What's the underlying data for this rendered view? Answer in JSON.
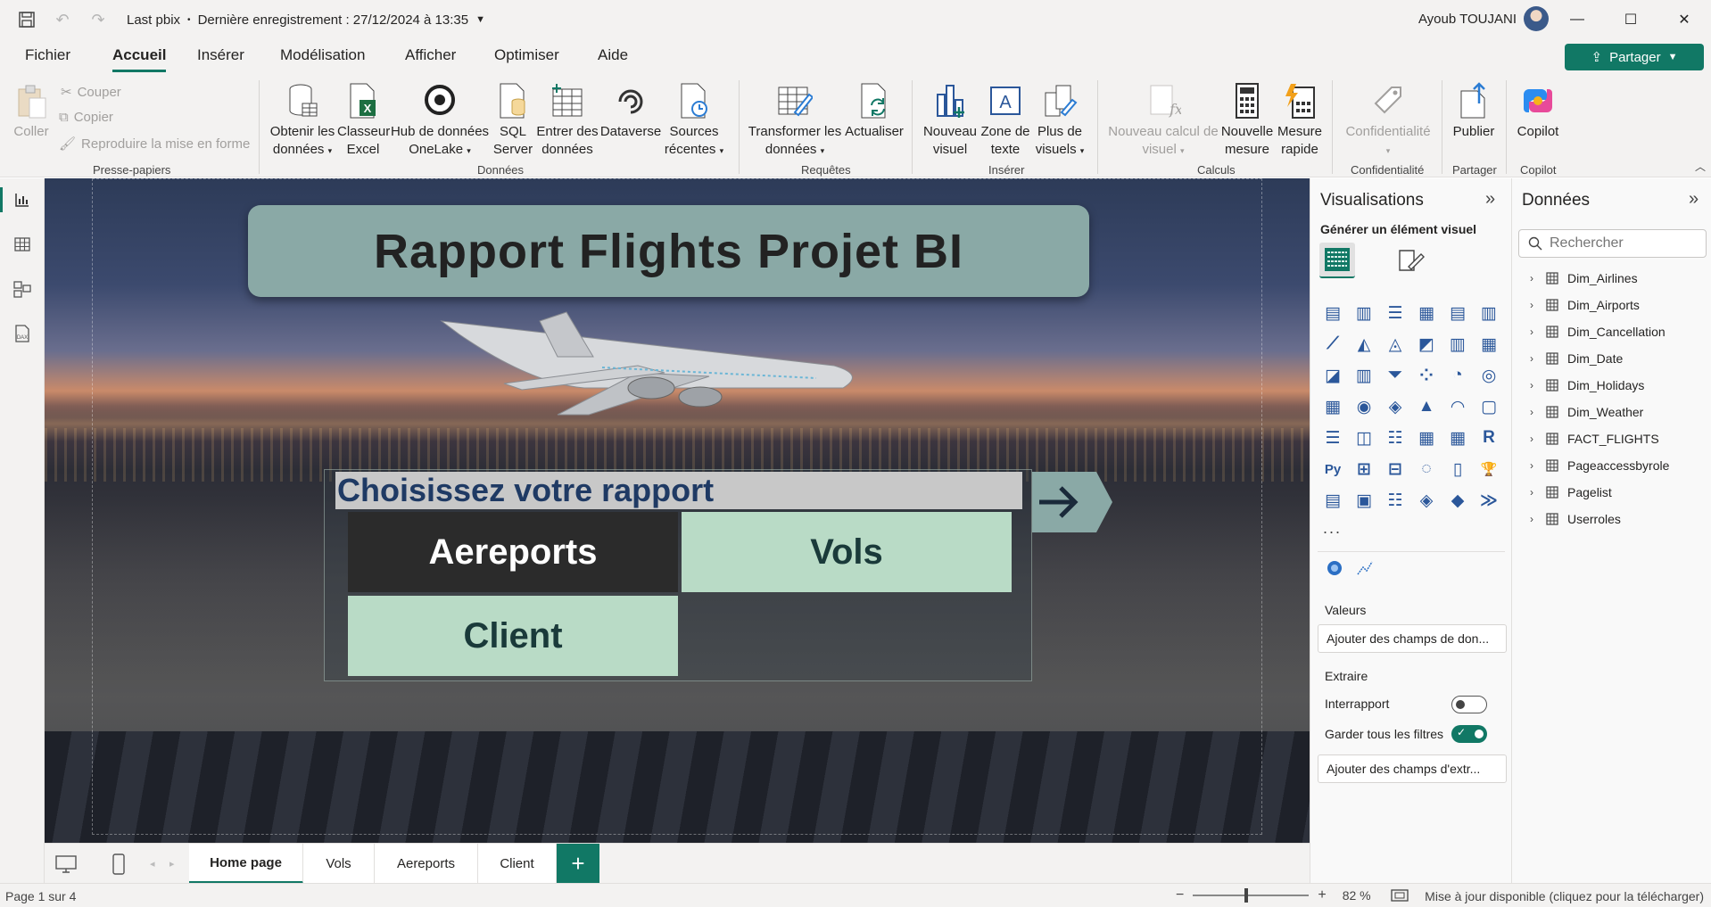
{
  "titlebar": {
    "file_name": "Last pbix",
    "save_status": "Dernière enregistrement : 27/12/2024 à 13:35",
    "user_name": "Ayoub TOUJANI"
  },
  "menu": {
    "tabs": [
      "Fichier",
      "Accueil",
      "Insérer",
      "Modélisation",
      "Afficher",
      "Optimiser",
      "Aide"
    ],
    "active": "Accueil",
    "share_label": "Partager"
  },
  "ribbon": {
    "clipboard": {
      "paste": "Coller",
      "cut": "Couper",
      "copy": "Copier",
      "format_painter": "Reproduire la mise en forme",
      "group": "Presse-papiers"
    },
    "data": {
      "get_data_1": "Obtenir les",
      "get_data_2": "données",
      "excel_1": "Classeur",
      "excel_2": "Excel",
      "onelake_1": "Hub de données",
      "onelake_2": "OneLake",
      "sql_1": "SQL",
      "sql_2": "Server",
      "enter_1": "Entrer des",
      "enter_2": "données",
      "dataverse": "Dataverse",
      "recent_1": "Sources",
      "recent_2": "récentes",
      "group": "Données"
    },
    "queries": {
      "transform_1": "Transformer les",
      "transform_2": "données",
      "refresh": "Actualiser",
      "group": "Requêtes"
    },
    "insert": {
      "new_visual_1": "Nouveau",
      "new_visual_2": "visuel",
      "textbox_1": "Zone de",
      "textbox_2": "texte",
      "more_visuals_1": "Plus de",
      "more_visuals_2": "visuels",
      "group": "Insérer"
    },
    "calculations": {
      "new_calc_1": "Nouveau calcul de",
      "new_calc_2": "visuel",
      "new_measure_1": "Nouvelle",
      "new_measure_2": "mesure",
      "quick_measure_1": "Mesure",
      "quick_measure_2": "rapide",
      "group": "Calculs"
    },
    "sensitivity": {
      "label": "Confidentialité",
      "group": "Confidentialité"
    },
    "share": {
      "publish": "Publier",
      "group": "Partager"
    },
    "copilot": {
      "label": "Copilot",
      "group": "Copilot"
    }
  },
  "canvas": {
    "title": "Rapport Flights Projet BI",
    "choose_heading": "Choisissez votre rapport",
    "buttons": {
      "aereports": "Aereports",
      "vols": "Vols",
      "client": "Client"
    }
  },
  "pages": {
    "tabs": [
      "Home page",
      "Vols",
      "Aereports",
      "Client"
    ],
    "active": "Home page",
    "add": "+"
  },
  "status": {
    "page_count": "Page 1 sur 4",
    "zoom": "82 %",
    "zoom_level": 0.44,
    "update": "Mise à jour disponible (cliquez pour la télécharger)"
  },
  "visualizations": {
    "title": "Visualisations",
    "subtitle": "Générer un élément visuel",
    "more": "...",
    "values_label": "Valeurs",
    "values_placeholder": "Ajouter des champs de don...",
    "drillthrough_label": "Extraire",
    "cross_report_label": "Interrapport",
    "cross_report_on": false,
    "keep_filters_label": "Garder tous les filtres",
    "keep_filters_on": true,
    "drillthrough_placeholder": "Ajouter des champs d'extr..."
  },
  "data_pane": {
    "title": "Données",
    "search_placeholder": "Rechercher",
    "tables": [
      "Dim_Airlines",
      "Dim_Airports",
      "Dim_Cancellation",
      "Dim_Date",
      "Dim_Holidays",
      "Dim_Weather",
      "FACT_FLIGHTS",
      "Pageaccessbyrole",
      "Pagelist",
      "Userroles"
    ]
  },
  "colors": {
    "accent": "#117865",
    "title_box": "#8aa9a6",
    "button_dark": "#2b2b2b",
    "button_light": "#b9dbc6",
    "heading_text": "#1f3a64"
  }
}
